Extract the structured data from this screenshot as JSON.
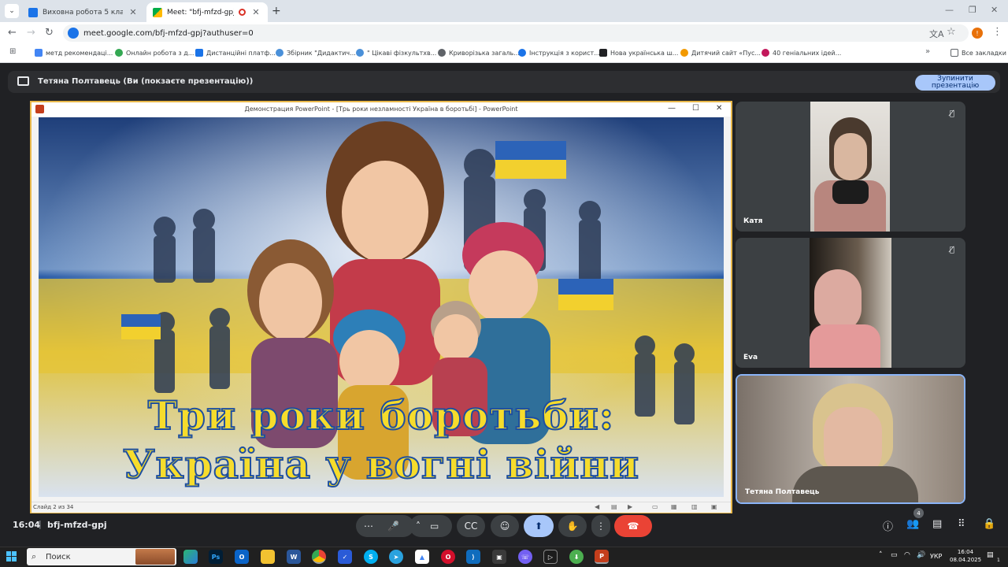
{
  "browser": {
    "tabs": [
      {
        "title": "Виховна робота 5 клас",
        "active": false
      },
      {
        "title": "Meet: \"bfj-mfzd-gpj\"",
        "active": true
      }
    ],
    "url": "meet.google.com/bfj-mfzd-gpj?authuser=0",
    "profile_initial": "!",
    "bookmarks": [
      "метд рекомендаці...",
      "Онлайн робота з д...",
      "Дистанційні платф...",
      "Збірник \"Дидактич...",
      "\" Цікаві фізкультхв...",
      "Криворізька загаль...",
      "Інструкція з корист...",
      "Нова українська ш...",
      "Дитячий сайт «Пус...",
      "40 геніальних ідей..."
    ],
    "all_bookmarks": "Все закладки"
  },
  "meet": {
    "presenting_text": "Тетяна Полтавець (Ви (покзаєте презентацію))",
    "stop_button_line1": "Зупинити",
    "stop_button_line2": "презентацію",
    "time": "16:04",
    "separator": "|",
    "meeting_code": "bfj-mfzd-gpj",
    "participant_count": "4",
    "participants": [
      {
        "name": "Катя",
        "muted": true
      },
      {
        "name": "Eva",
        "muted": true
      },
      {
        "name": "Тетяна Полтавець",
        "muted": false
      }
    ]
  },
  "powerpoint": {
    "window_title": "Демонстрация PowerPoint - [Трь роки незламності Україна в боротьбі] - PowerPoint",
    "slide_title_line1": "Три роки боротьби:",
    "slide_title_line2": "Україна у вогні війни",
    "slide_counter": "Слайд 2 из 34"
  },
  "taskbar": {
    "search_placeholder": "Поиск",
    "language": "УКР",
    "clock_time": "16:04",
    "clock_date": "08.04.2025",
    "notification_count": "1"
  },
  "colors": {
    "meet_bg": "#202124",
    "accent_blue": "#a8c7fa",
    "end_call_red": "#ea4335",
    "ukraine_blue": "#1e4fa0",
    "ukraine_yellow": "#f6dc2c"
  }
}
